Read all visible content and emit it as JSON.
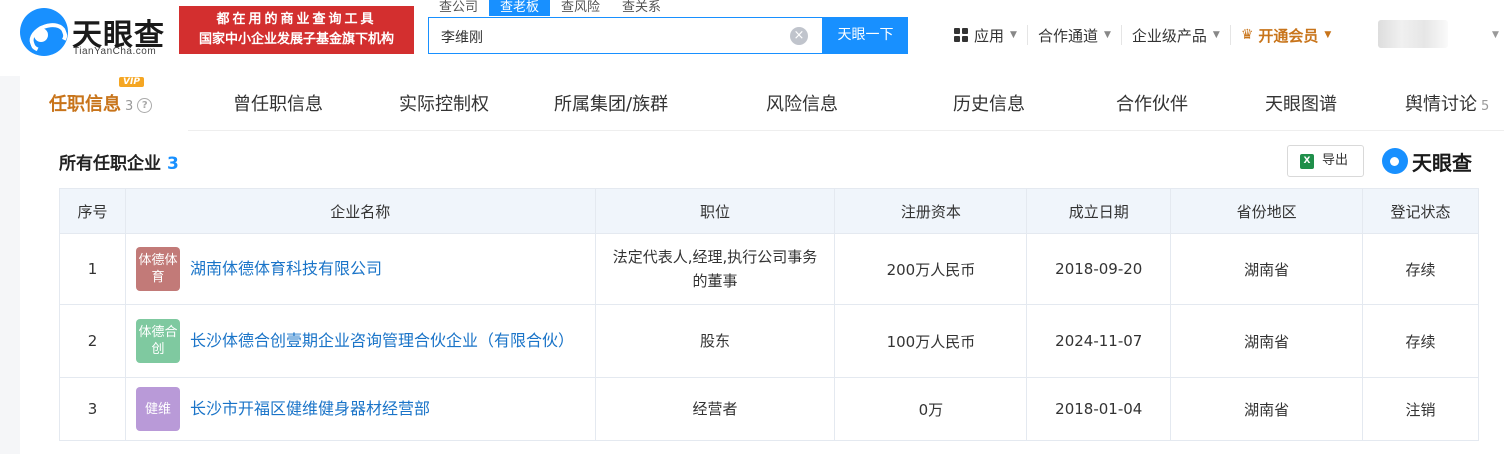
{
  "header": {
    "logo_cn": "天眼查",
    "logo_en": "TianYanCha.com",
    "banner_line1": "都在用的商业查询工具",
    "banner_line2": "国家中小企业发展子基金旗下机构",
    "search_tabs": [
      "查公司",
      "查老板",
      "查风险",
      "查关系"
    ],
    "search_value": "李维刚",
    "search_button": "天眼一下",
    "nav": {
      "apps": "应用",
      "channel": "合作通道",
      "enterprise": "企业级产品",
      "vip": "开通会员"
    }
  },
  "tabs": {
    "active_label": "任职信息",
    "active_count": "3",
    "vip_badge": "VIP",
    "items": [
      "曾任职信息",
      "实际控制权",
      "所属集团/族群",
      "风险信息",
      "历史信息",
      "合作伙伴",
      "天眼图谱",
      "舆情讨论"
    ],
    "last_count": "5"
  },
  "section": {
    "title": "所有任职企业",
    "count": "3",
    "export_label": "导出",
    "brand": "天眼查"
  },
  "table": {
    "headers": [
      "序号",
      "企业名称",
      "职位",
      "注册资本",
      "成立日期",
      "省份地区",
      "登记状态"
    ],
    "rows": [
      {
        "index": "1",
        "logo_text": "体德体育",
        "logo_color": "#c27a78",
        "name": "湖南体德体育科技有限公司",
        "position": "法定代表人,经理,执行公司事务的董事",
        "capital": "200万人民币",
        "date": "2018-09-20",
        "region": "湖南省",
        "status": "存续"
      },
      {
        "index": "2",
        "logo_text": "体德合创",
        "logo_color": "#7fc9a0",
        "name": "长沙体德合创壹期企业咨询管理合伙企业（有限合伙）",
        "position": "股东",
        "capital": "100万人民币",
        "date": "2024-11-07",
        "region": "湖南省",
        "status": "存续"
      },
      {
        "index": "3",
        "logo_text": "健维",
        "logo_color": "#b99ad8",
        "name": "长沙市开福区健维健身器材经营部",
        "position": "经营者",
        "capital": "0万",
        "date": "2018-01-04",
        "region": "湖南省",
        "status": "注销"
      }
    ]
  }
}
